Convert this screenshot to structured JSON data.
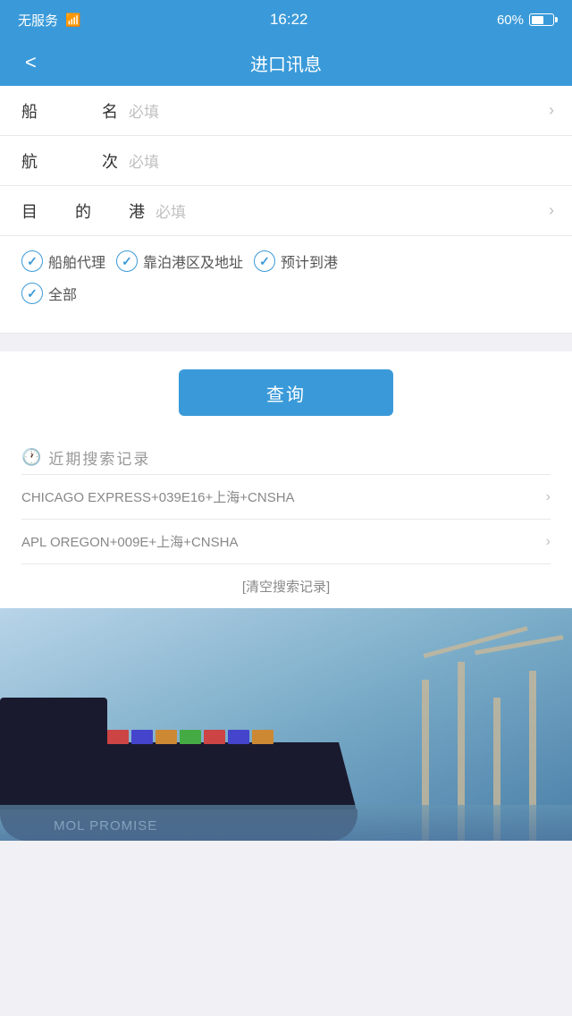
{
  "statusBar": {
    "carrier": "无服务",
    "time": "16:22",
    "battery": "60%",
    "wifiSymbol": "📶"
  },
  "navBar": {
    "backLabel": "<",
    "title": "进口讯息"
  },
  "form": {
    "shipName": {
      "label": "船　　名",
      "placeholder": "必填",
      "hasArrow": true
    },
    "voyageNo": {
      "label": "航　　次",
      "placeholder": "必填",
      "hasArrow": false
    },
    "destinationPort": {
      "label": "目　的　港",
      "placeholder": "必填",
      "hasArrow": true
    }
  },
  "checkboxes": {
    "row1": [
      {
        "id": "agency",
        "label": "船舶代理",
        "checked": true
      },
      {
        "id": "berth",
        "label": "靠泊港区及地址",
        "checked": true
      },
      {
        "id": "eta",
        "label": "预计到港",
        "checked": true
      }
    ],
    "row2": [
      {
        "id": "all",
        "label": "全部",
        "checked": true
      }
    ]
  },
  "queryButton": {
    "label": "查询"
  },
  "recentSearches": {
    "title": "近期搜索记录",
    "items": [
      {
        "text": "CHICAGO EXPRESS+039E16+上海+CNSHA"
      },
      {
        "text": "APL OREGON+009E+上海+CNSHA"
      }
    ],
    "clearLabel": "[清空搜索记录]"
  },
  "bottomImage": {
    "shipName": "MOL PROMISE"
  },
  "colors": {
    "primary": "#3a9ad9",
    "textDark": "#333333",
    "textLight": "#c0c0c0",
    "textGray": "#888888",
    "background": "#f0f0f5"
  }
}
